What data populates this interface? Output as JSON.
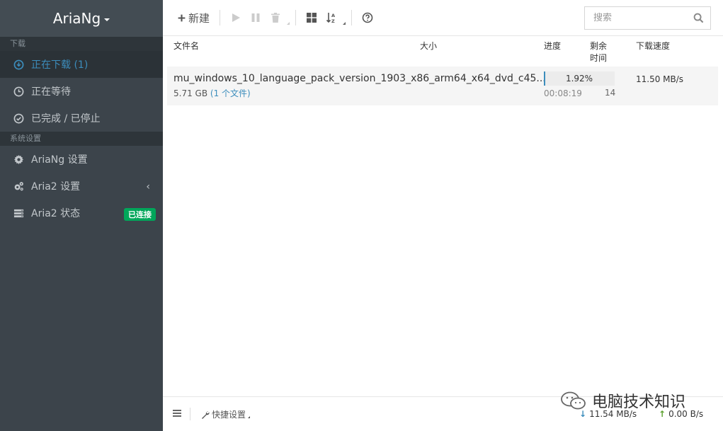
{
  "brand": {
    "title": "AriaNg"
  },
  "sidebar": {
    "sections": [
      {
        "header": "下载"
      },
      {
        "header": "系统设置"
      }
    ],
    "download_items": [
      {
        "label": "正在下载 (1)",
        "icon": "download-circle-icon"
      },
      {
        "label": "正在等待",
        "icon": "clock-icon"
      },
      {
        "label": "已完成 / 已停止",
        "icon": "check-circle-icon"
      }
    ],
    "settings_items": [
      {
        "label": "AriaNg 设置",
        "icon": "gear-icon"
      },
      {
        "label": "Aria2 设置",
        "icon": "gears-icon"
      },
      {
        "label": "Aria2 状态",
        "icon": "server-icon",
        "badge": "已连接"
      }
    ]
  },
  "toolbar": {
    "new_label": "新建",
    "search_placeholder": "搜索"
  },
  "table": {
    "headers": {
      "name": "文件名",
      "size": "大小",
      "progress": "进度",
      "remaining_l1": "剩余",
      "remaining_l2": "时间",
      "speed": "下载速度"
    },
    "tasks": [
      {
        "name": "mu_windows_10_language_pack_version_1903_x86_arm64_x64_dvd_c45...",
        "size": "5.71 GB",
        "files": "(1 个文件)",
        "progress_text": "1.92%",
        "progress_value": 1.92,
        "remaining": "00:08:19",
        "connections": "14",
        "speed": "11.50 MB/s"
      }
    ]
  },
  "footer": {
    "quick_settings": "快捷设置",
    "download_speed": "11.54 MB/s",
    "upload_speed": "0.00 B/s"
  },
  "watermark": {
    "text": "电脑技术知识"
  },
  "colors": {
    "sidebar_bg": "#3c444b",
    "active_text": "#3c8dbc",
    "badge_green": "#00a65a",
    "download_arrow": "#3c8dbc",
    "upload_arrow": "#5aa02c"
  }
}
